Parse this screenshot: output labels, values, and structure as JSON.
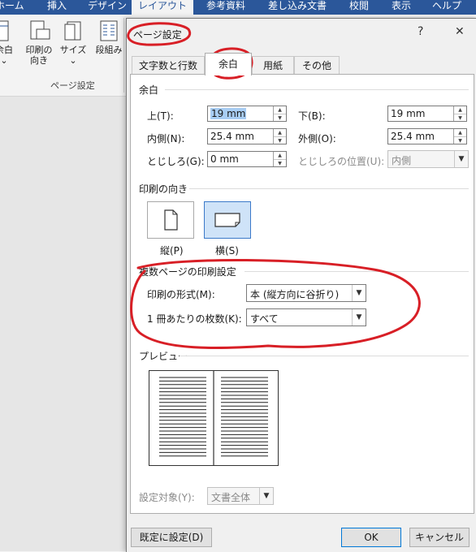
{
  "ribbon": {
    "tabs": [
      "ホーム",
      "挿入",
      "デザイン",
      "レイアウト",
      "参考資料",
      "差し込み文書",
      "校閲",
      "表示",
      "ヘルプ"
    ],
    "buttons": [
      {
        "label": "余白",
        "icon": "margins-icon"
      },
      {
        "label": "印刷の向き",
        "icon": "orientation-icon"
      },
      {
        "label": "サイズ",
        "icon": "size-icon"
      },
      {
        "label": "段組み",
        "icon": "columns-icon"
      }
    ],
    "group_label": "ページ設定"
  },
  "dialog": {
    "title": "ページ設定",
    "help": "?",
    "close": "✕",
    "tabs": [
      "文字数と行数",
      "余白",
      "用紙",
      "その他"
    ],
    "selected_tab": "余白",
    "margins": {
      "heading": "余白",
      "top_label": "上(T):",
      "top_value": "19 mm",
      "bottom_label": "下(B):",
      "bottom_value": "19 mm",
      "inner_label": "内側(N):",
      "inner_value": "25.4 mm",
      "outer_label": "外側(O):",
      "outer_value": "25.4 mm",
      "gutter_label": "とじしろ(G):",
      "gutter_value": "0 mm",
      "gutter_pos_label": "とじしろの位置(U):",
      "gutter_pos_value": "内側"
    },
    "orientation": {
      "heading": "印刷の向き",
      "portrait": "縦(P)",
      "landscape": "横(S)",
      "selected": "横(S)"
    },
    "pages": {
      "heading": "複数ページの印刷設定",
      "format_label": "印刷の形式(M):",
      "format_value": "本 (縦方向に谷折り)",
      "sheets_label": "1 冊あたりの枚数(K):",
      "sheets_value": "すべて"
    },
    "preview": {
      "heading": "プレビュー"
    },
    "apply_label": "設定対象(Y):",
    "apply_value": "文書全体",
    "default_button": "既定に設定(D)",
    "ok_button": "OK",
    "cancel_button": "キャンセル"
  },
  "colors": {
    "ribbon_blue": "#2b579a",
    "annotation_red": "#d81f26",
    "selected_blue": "#cfe3f8"
  }
}
